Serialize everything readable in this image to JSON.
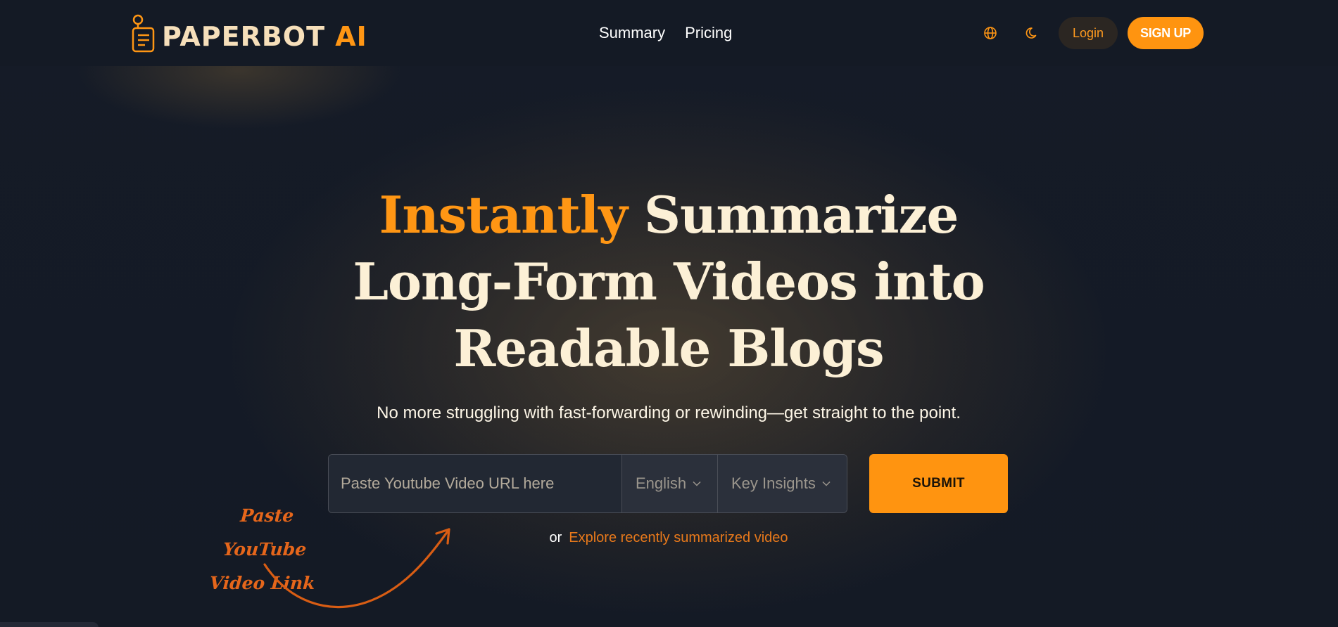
{
  "brand": {
    "name_main": "PAPERBOT",
    "name_accent": "AI"
  },
  "nav": {
    "links": [
      "Summary",
      "Pricing"
    ],
    "language_icon": "globe-icon",
    "theme_icon": "moon-icon",
    "login_label": "Login",
    "signup_label": "SIGN UP"
  },
  "hero": {
    "title_accent": "Instantly",
    "title_rest_line1": " Summarize",
    "title_line2": "Long-Form Videos into",
    "title_line3": "Readable Blogs",
    "subtitle": "No more struggling with fast-forwarding or rewinding—get straight to the point."
  },
  "form": {
    "url_placeholder": "Paste Youtube Video URL here",
    "language_selected": "English",
    "mode_selected": "Key Insights",
    "submit_label": "SUBMIT",
    "or_text": "or",
    "explore_link": "Explore recently summarized video"
  },
  "hint": {
    "line1": "Paste YouTube",
    "line2": "Video Link"
  },
  "colors": {
    "accent": "#ff9410",
    "background": "#151b27",
    "heading": "#fcf0d6",
    "link": "#e8791b"
  }
}
